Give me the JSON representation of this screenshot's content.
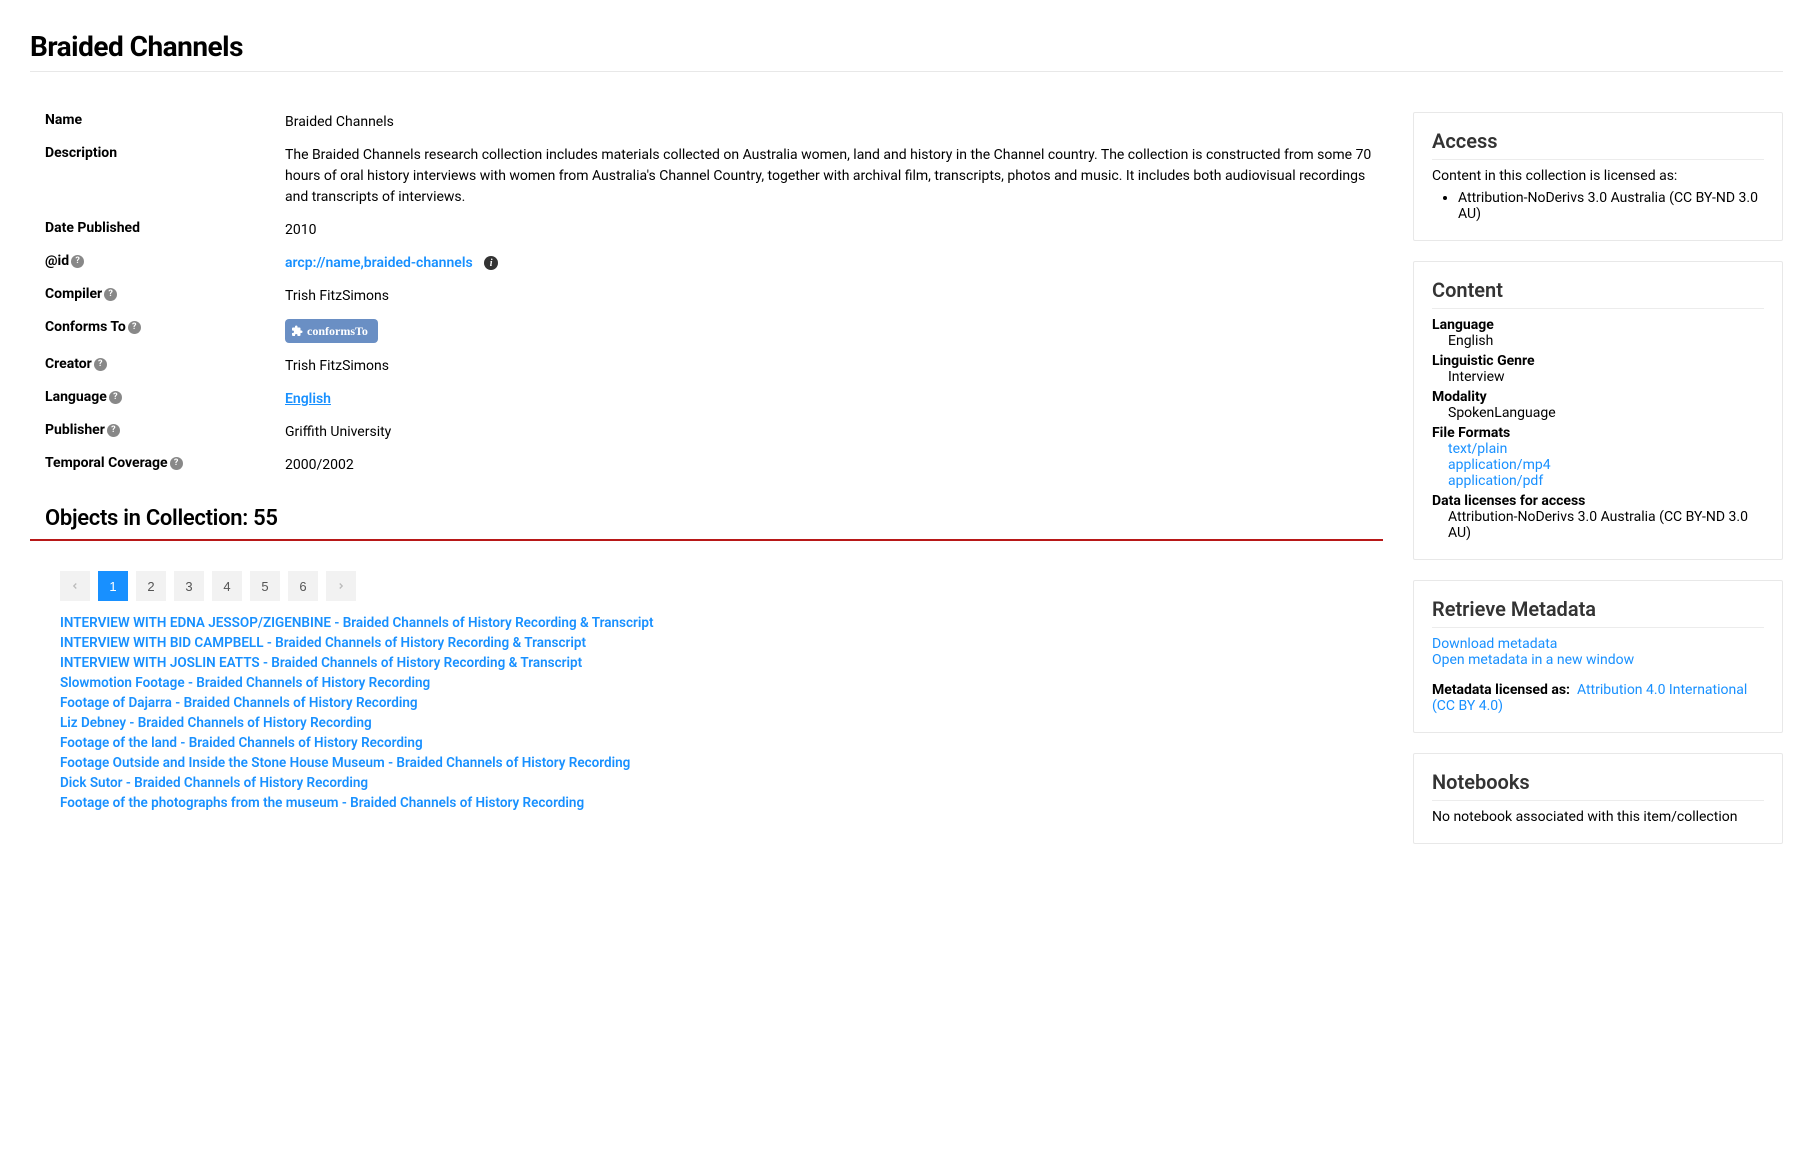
{
  "title": "Braided Channels",
  "meta": {
    "name_label": "Name",
    "name_value": "Braided Channels",
    "description_label": "Description",
    "description_value": "The Braided Channels research collection includes materials collected on Australia women, land and history in the Channel country. The collection is constructed from some 70 hours of oral history interviews with women from Australia's Channel Country, together with archival film, transcripts, photos and music. It includes both audiovisual recordings and transcripts of interviews.",
    "date_published_label": "Date Published",
    "date_published_value": "2010",
    "id_label": "@id",
    "id_value": "arcp://name,braided-channels",
    "compiler_label": "Compiler",
    "compiler_value": "Trish FitzSimons",
    "conforms_to_label": "Conforms To",
    "conforms_to_badge": "conformsTo",
    "creator_label": "Creator",
    "creator_value": "Trish FitzSimons",
    "language_label": "Language",
    "language_value": "English",
    "publisher_label": "Publisher",
    "publisher_value": "Griffith University",
    "temporal_label": "Temporal Coverage",
    "temporal_value": "2000/2002"
  },
  "objects": {
    "heading": "Objects in Collection: 55",
    "pages": [
      "1",
      "2",
      "3",
      "4",
      "5",
      "6"
    ],
    "items": [
      "INTERVIEW WITH EDNA JESSOP/ZIGENBINE - Braided Channels of History Recording & Transcript",
      "INTERVIEW WITH BID CAMPBELL - Braided Channels of History Recording & Transcript",
      "INTERVIEW WITH JOSLIN EATTS - Braided Channels of History Recording & Transcript",
      "Slowmotion Footage - Braided Channels of History Recording",
      "Footage of Dajarra - Braided Channels of History Recording",
      "Liz Debney - Braided Channels of History Recording",
      "Footage of the land - Braided Channels of History Recording",
      "Footage Outside and Inside the Stone House Museum - Braided Channels of History Recording",
      "Dick Sutor - Braided Channels of History Recording",
      "Footage of the photographs from the museum - Braided Channels of History Recording"
    ]
  },
  "access": {
    "heading": "Access",
    "intro": "Content in this collection is licensed as:",
    "license": "Attribution-NoDerivs 3.0 Australia (CC BY-ND 3.0 AU)"
  },
  "content": {
    "heading": "Content",
    "language_label": "Language",
    "language_value": "English",
    "genre_label": "Linguistic Genre",
    "genre_value": "Interview",
    "modality_label": "Modality",
    "modality_value": "SpokenLanguage",
    "formats_label": "File Formats",
    "formats": [
      "text/plain",
      "application/mp4",
      "application/pdf"
    ],
    "licenses_label": "Data licenses for access",
    "licenses_value": "Attribution-NoDerivs 3.0 Australia (CC BY-ND 3.0 AU)"
  },
  "retrieve": {
    "heading": "Retrieve Metadata",
    "download": "Download metadata",
    "open": "Open metadata in a new window",
    "licensed_label": "Metadata licensed as:",
    "licensed_value": "Attribution 4.0 International (CC BY 4.0)"
  },
  "notebooks": {
    "heading": "Notebooks",
    "empty": "No notebook associated with this item/collection"
  }
}
